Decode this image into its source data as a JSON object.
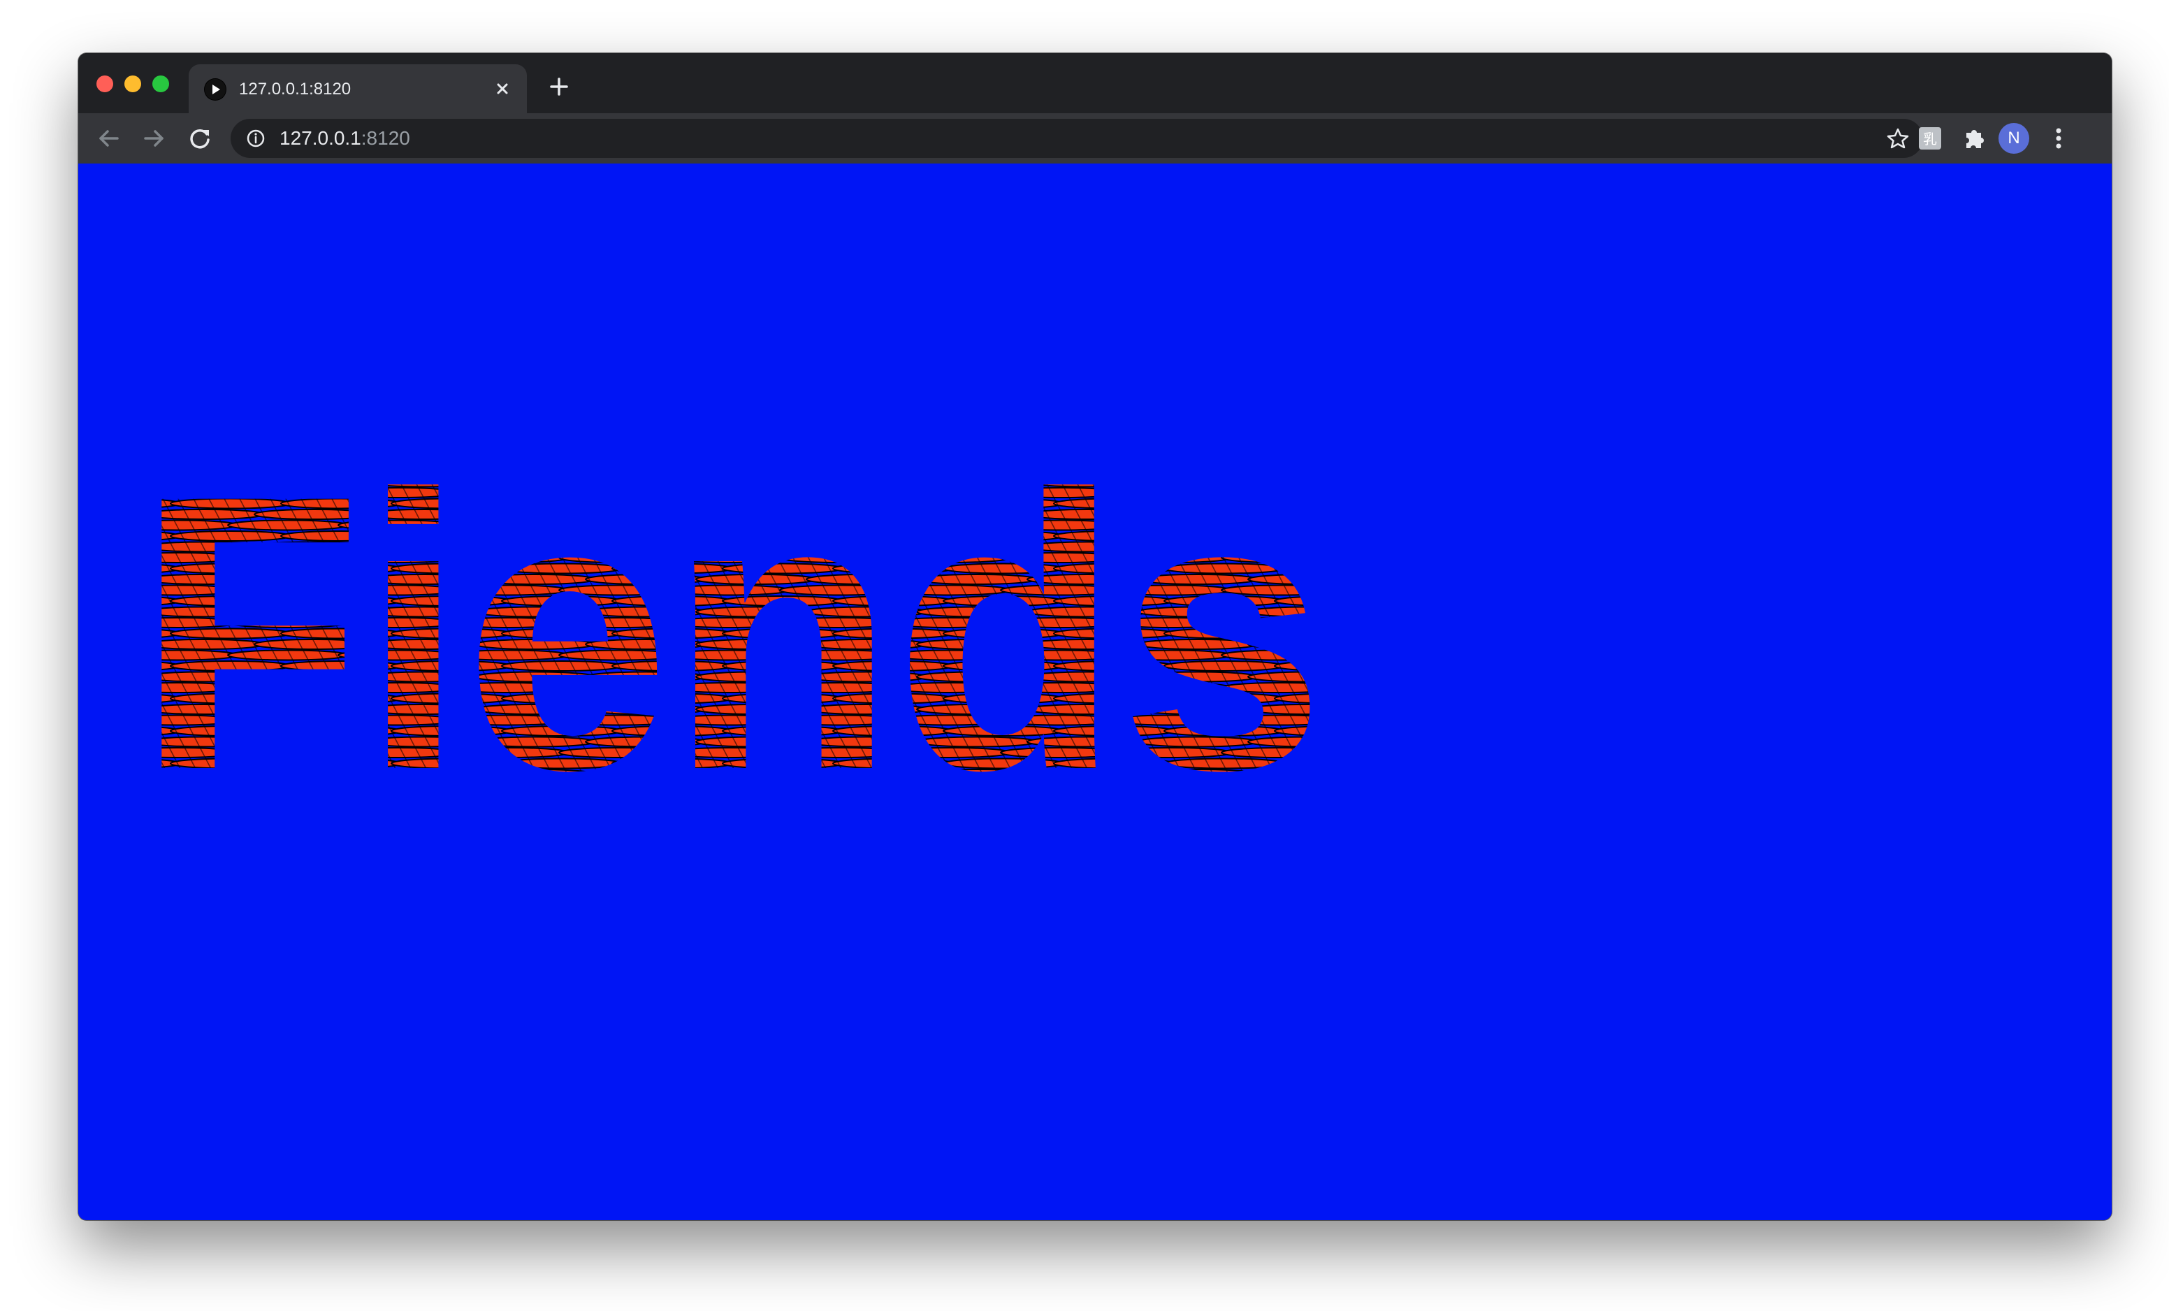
{
  "browser": {
    "tab": {
      "title": "127.0.0.1:8120",
      "favicon": "play-icon"
    },
    "address": {
      "host": "127.0.0.1",
      "port": ":8120"
    },
    "profile_initial": "N"
  },
  "page": {
    "background_color": "#0015f5",
    "word": "Fiends",
    "fill_color": "#f2380f",
    "stroke_color": "#000000"
  }
}
